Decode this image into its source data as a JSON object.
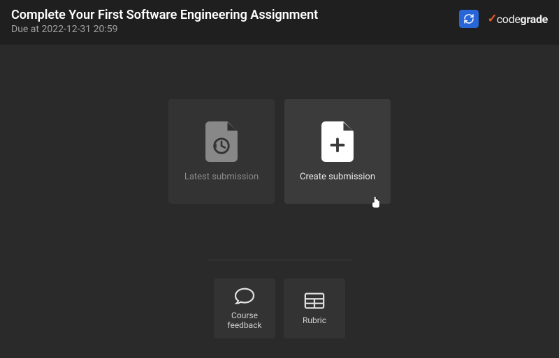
{
  "header": {
    "title": "Complete Your First Software Engineering Assignment",
    "due_prefix": "Due at ",
    "due_datetime": "2022-12-31 20:59"
  },
  "logo": {
    "mark": "✓",
    "text_normal": "code",
    "text_bold": "grade"
  },
  "cards": {
    "latest_submission": "Latest submission",
    "create_submission": "Create submission"
  },
  "actions": {
    "course_feedback": "Course\nfeedback",
    "rubric": "Rubric"
  },
  "colors": {
    "accent": "#2866d8",
    "brand": "#e65a2e"
  }
}
